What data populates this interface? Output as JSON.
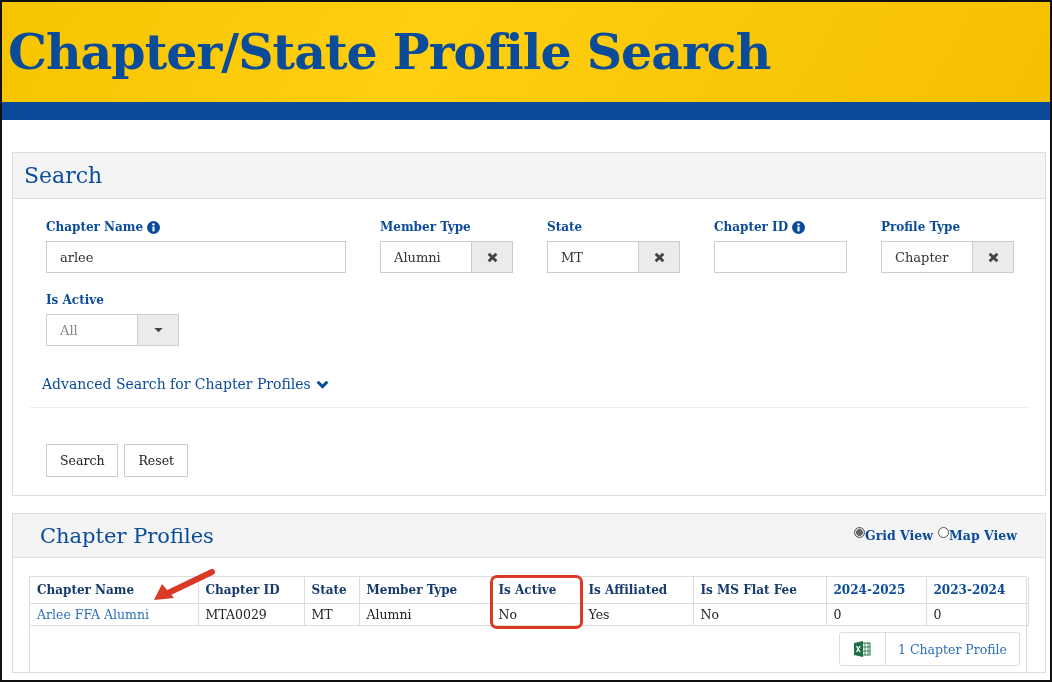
{
  "banner": {
    "title": "Chapter/State Profile Search"
  },
  "search_panel": {
    "title": "Search",
    "fields": [
      {
        "label": "Chapter Name",
        "info": true,
        "kind": "text",
        "value": "arlee",
        "wide": true
      },
      {
        "label": "Member Type",
        "info": false,
        "kind": "clearable",
        "value": "Alumni",
        "wide": false
      },
      {
        "label": "State",
        "info": false,
        "kind": "clearable",
        "value": "MT",
        "wide": false
      },
      {
        "label": "Chapter ID",
        "info": true,
        "kind": "text",
        "wide": false
      },
      {
        "label": "Profile Type",
        "info": false,
        "kind": "clearable",
        "value": "Chapter",
        "wide": false
      },
      {
        "label": "Is Active",
        "info": false,
        "kind": "dropdown",
        "placeholder": "All",
        "wide": false
      }
    ],
    "advanced_link": "Advanced Search for Chapter Profiles",
    "buttons": [
      "Search",
      "Reset"
    ]
  },
  "results_panel": {
    "title": "Chapter Profiles",
    "views": [
      {
        "label": "Grid View",
        "selected": true
      },
      {
        "label": "Map View",
        "selected": false
      }
    ],
    "table": {
      "columns": [
        {
          "label": "Chapter Name",
          "sortable": false
        },
        {
          "label": "Chapter ID",
          "sortable": false
        },
        {
          "label": "State",
          "sortable": false
        },
        {
          "label": "Member Type",
          "sortable": false
        },
        {
          "label": "Is Active",
          "sortable": false
        },
        {
          "label": "Is Affiliated",
          "sortable": false
        },
        {
          "label": "Is MS Flat Fee",
          "sortable": false
        },
        {
          "label": "2024-2025",
          "sortable": true
        },
        {
          "label": "2023-2024",
          "sortable": true
        }
      ],
      "rows": [
        [
          "Arlee FFA Alumni",
          "MTA0029",
          "MT",
          "Alumni",
          "No",
          "Yes",
          "No",
          "0",
          "0"
        ]
      ]
    },
    "export_button": "1 Chapter Profile"
  }
}
